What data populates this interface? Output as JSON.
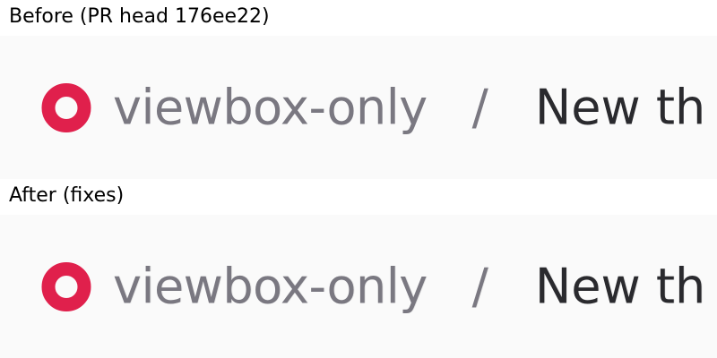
{
  "before": {
    "label": "Before (PR head 176ee22)",
    "breadcrumb": {
      "icon": "ring-icon",
      "repo": "viewbox-only",
      "separator": "/",
      "title": "New th"
    }
  },
  "after": {
    "label": "After (fixes)",
    "breadcrumb": {
      "icon": "ring-icon",
      "repo": "viewbox-only",
      "separator": "/",
      "title": "New th"
    }
  },
  "colors": {
    "accent": "#e0204c",
    "repo_text": "#7a7881",
    "title_text": "#2a2a2e",
    "panel_bg": "#fafafa"
  }
}
